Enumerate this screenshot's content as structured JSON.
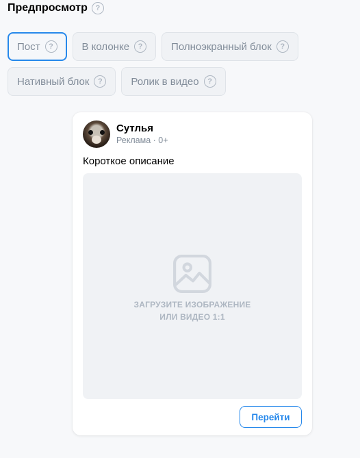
{
  "preview": {
    "title": "Предпросмотр",
    "help_glyph": "?"
  },
  "tabs": [
    {
      "label": "Пост",
      "active": true
    },
    {
      "label": "В колонке",
      "active": false
    },
    {
      "label": "Полноэкранный блок",
      "active": false
    },
    {
      "label": "Нативный блок",
      "active": false
    },
    {
      "label": "Ролик в видео",
      "active": false
    }
  ],
  "post": {
    "author": "Сутлья",
    "meta": "Реклама · 0+",
    "description": "Короткое описание",
    "upload_line1": "ЗАГРУЗИТЕ ИЗОБРАЖЕНИЕ",
    "upload_line2": "ИЛИ ВИДЕО 1:1",
    "button_label": "Перейти"
  },
  "icons": {
    "help": "question-circle-icon",
    "upload": "image-placeholder-icon"
  },
  "colors": {
    "accent": "#2688eb",
    "muted_text": "#818c99",
    "placeholder": "#aeb7c2",
    "background": "#f7f8fa"
  }
}
